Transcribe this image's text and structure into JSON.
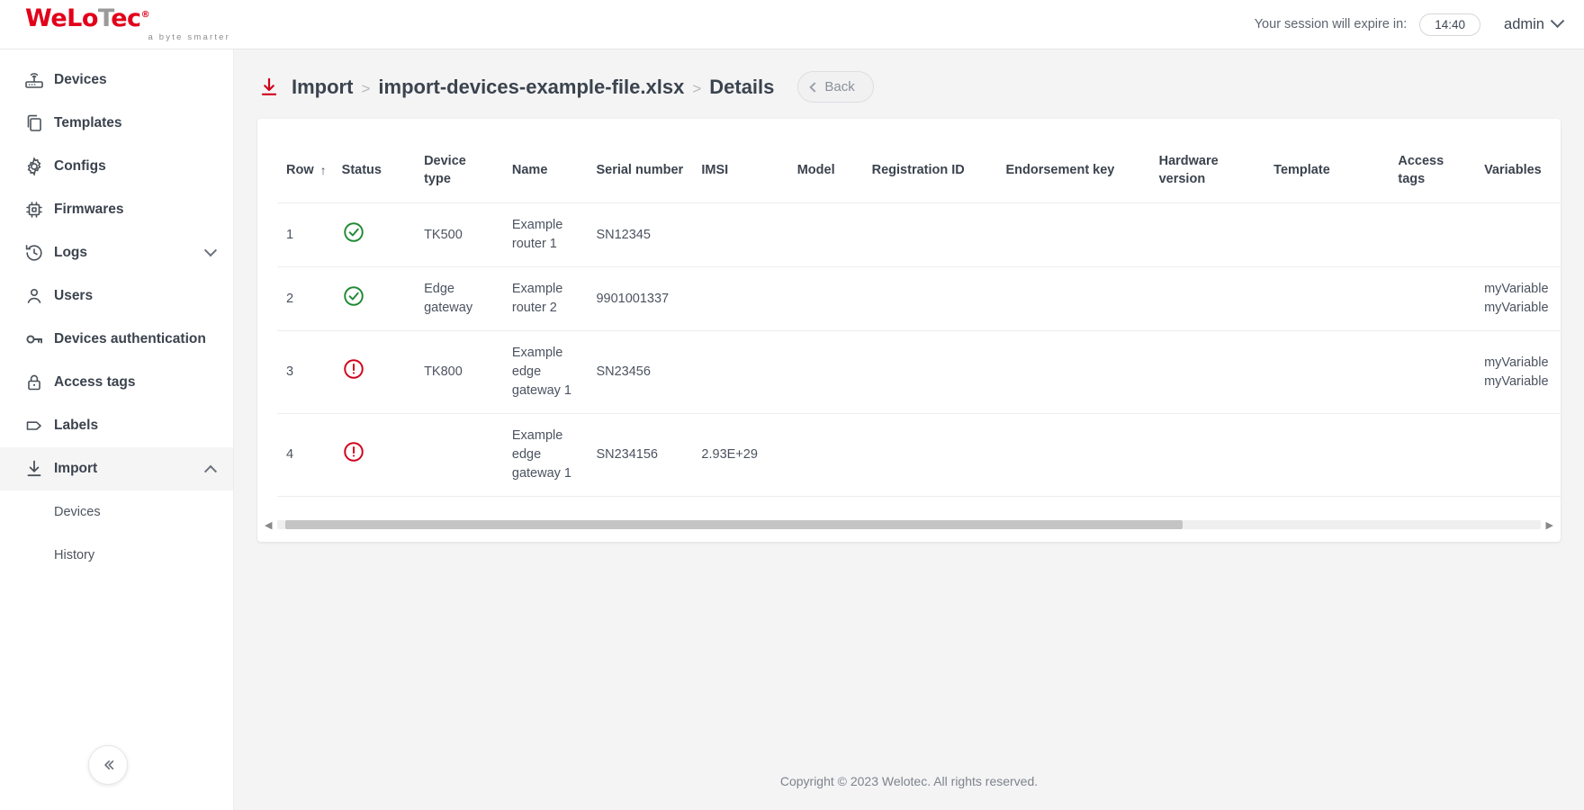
{
  "brand": {
    "name_part1": "WeLo",
    "name_part2": "T",
    "name_part3": "ec",
    "trademark": "®",
    "tagline": "a byte smarter",
    "accent_color": "#e2001a"
  },
  "topbar": {
    "session_label": "Your session will expire in:",
    "session_time": "14:40",
    "user_name": "admin",
    "chevron_icon": "chevron-down-icon"
  },
  "sidebar": {
    "items": [
      {
        "label": "Devices",
        "icon": "router-icon",
        "active": false,
        "expandable": false
      },
      {
        "label": "Templates",
        "icon": "copy-icon",
        "active": false,
        "expandable": false
      },
      {
        "label": "Configs",
        "icon": "gear-icon",
        "active": false,
        "expandable": false
      },
      {
        "label": "Firmwares",
        "icon": "chip-icon",
        "active": false,
        "expandable": false
      },
      {
        "label": "Logs",
        "icon": "history-icon",
        "active": false,
        "expandable": true,
        "expanded": false
      },
      {
        "label": "Users",
        "icon": "user-icon",
        "active": false,
        "expandable": false
      },
      {
        "label": "Devices authentication",
        "icon": "key-icon",
        "active": false,
        "expandable": false
      },
      {
        "label": "Access tags",
        "icon": "lock-icon",
        "active": false,
        "expandable": false
      },
      {
        "label": "Labels",
        "icon": "tag-icon",
        "active": false,
        "expandable": false
      },
      {
        "label": "Import",
        "icon": "import-icon",
        "active": true,
        "expandable": true,
        "expanded": true
      }
    ],
    "subitems": [
      {
        "label": "Devices"
      },
      {
        "label": "History"
      }
    ],
    "collapse_icon": "double-chevron-left-icon"
  },
  "page": {
    "icon": "import-icon",
    "breadcrumb_1": "Import",
    "separator": ">",
    "breadcrumb_2": "import-devices-example-file.xlsx",
    "breadcrumb_3": "Details",
    "back_label": "Back",
    "back_icon": "chevron-left-icon"
  },
  "table": {
    "columns": [
      {
        "label": "Row",
        "sort_icon": "sort-asc-arrow",
        "sorted": true
      },
      {
        "label": "Status"
      },
      {
        "label": "Device type"
      },
      {
        "label": "Name"
      },
      {
        "label": "Serial number"
      },
      {
        "label": "IMSI"
      },
      {
        "label": "Model"
      },
      {
        "label": "Registration ID"
      },
      {
        "label": "Endorsement key"
      },
      {
        "label": "Hardware version"
      },
      {
        "label": "Template"
      },
      {
        "label": "Access tags"
      },
      {
        "label": "Variables"
      }
    ],
    "rows": [
      {
        "row": "1",
        "status": "ok",
        "status_icon": "check-circle-icon",
        "device_type": "TK500",
        "name": "Example router 1",
        "serial_number": "SN12345",
        "imsi": "",
        "model": "",
        "registration_id": "",
        "endorsement_key": "",
        "hardware_version": "",
        "template": "",
        "access_tags": "",
        "variables": ""
      },
      {
        "row": "2",
        "status": "ok",
        "status_icon": "check-circle-icon",
        "device_type": "Edge gateway",
        "name": "Example router 2",
        "serial_number": "9901001337",
        "imsi": "",
        "model": "",
        "registration_id": "",
        "endorsement_key": "",
        "hardware_version": "",
        "template": "",
        "access_tags": "",
        "variables": "myVariable myVariable"
      },
      {
        "row": "3",
        "status": "error",
        "status_icon": "error-circle-icon",
        "device_type": "TK800",
        "name": "Example edge gateway 1",
        "serial_number": "SN23456",
        "imsi": "",
        "model": "",
        "registration_id": "",
        "endorsement_key": "",
        "hardware_version": "",
        "template": "",
        "access_tags": "",
        "variables": "myVariable myVariable"
      },
      {
        "row": "4",
        "status": "error",
        "status_icon": "error-circle-icon",
        "device_type": "",
        "name": "Example edge gateway 1",
        "serial_number": "SN234156",
        "imsi": "2.93E+29",
        "model": "",
        "registration_id": "",
        "endorsement_key": "",
        "hardware_version": "",
        "template": "",
        "access_tags": "",
        "variables": ""
      }
    ],
    "status_colors": {
      "ok": "#1f8a32",
      "error": "#d0021b"
    },
    "scrollbar": {
      "left_arrow": "◀",
      "right_arrow": "▶",
      "thumb_percent": 71
    }
  },
  "footer": {
    "copyright": "Copyright © 2023 Welotec. All rights reserved."
  }
}
